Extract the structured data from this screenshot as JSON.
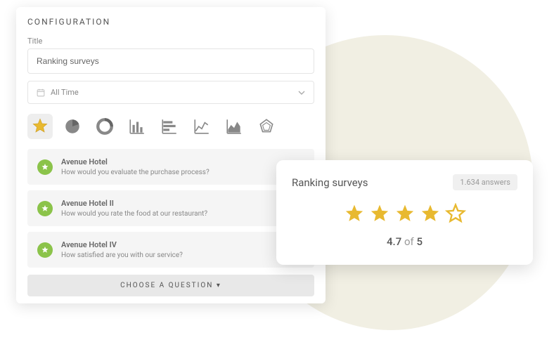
{
  "config": {
    "header": "CONFIGURATION",
    "titleLabel": "Title",
    "titleValue": "Ranking surveys",
    "dateValue": "All Time",
    "chooseBtn": "CHOOSE A QUESTION ▾"
  },
  "chartTypes": [
    "star-rating",
    "pie",
    "donut",
    "bar",
    "bar-horizontal",
    "line",
    "area",
    "radar"
  ],
  "questions": [
    {
      "title": "Avenue Hotel",
      "sub": "How would you evaluate the purchase process?"
    },
    {
      "title": "Avenue Hotel II",
      "sub": "How would you rate the food at our restaurant?"
    },
    {
      "title": "Avenue Hotel IV",
      "sub": "How satisfied are you with our service?"
    }
  ],
  "result": {
    "title": "Ranking surveys",
    "answers": "1.634 answers",
    "score": "4.7",
    "scoreOf": " of ",
    "scoreMax": "5",
    "starsFilled": 4,
    "starsTotal": 5
  },
  "colors": {
    "starGold": "#e8b930",
    "badgeGreen": "#8bc34a"
  }
}
